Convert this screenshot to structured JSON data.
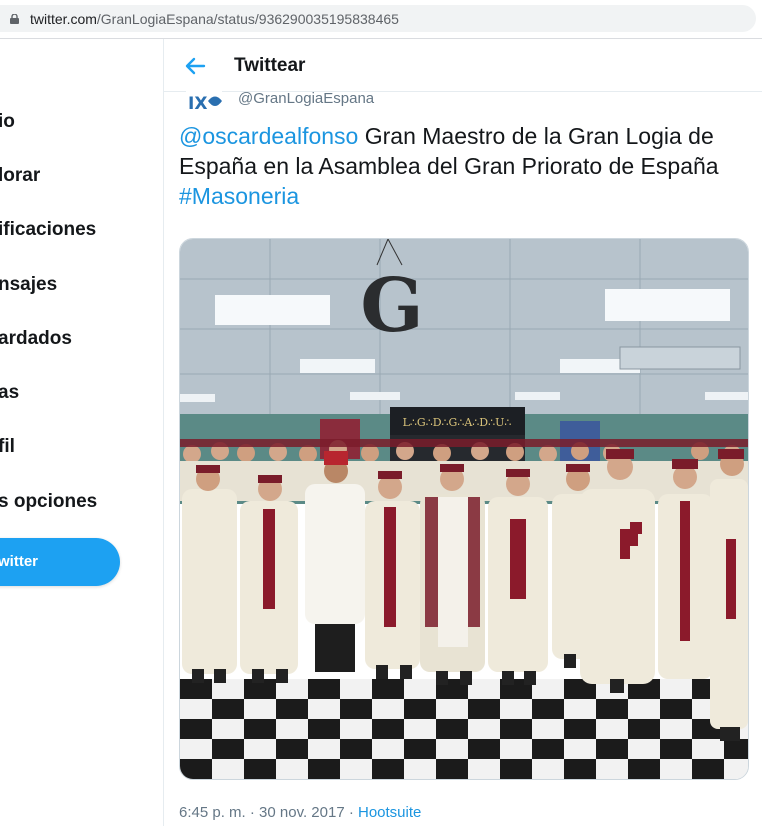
{
  "browser": {
    "url_host": "twitter.com",
    "url_path": "/GranLogiaEspana/status/936290035195838465"
  },
  "sidebar": {
    "items": [
      {
        "label": "io"
      },
      {
        "label": "lorar"
      },
      {
        "label": "ificaciones"
      },
      {
        "label": "nsajes"
      },
      {
        "label": "ardados"
      },
      {
        "label": "as"
      },
      {
        "label": "fil"
      },
      {
        "label": "s opciones"
      }
    ],
    "tweet_button": "witter"
  },
  "header": {
    "title": "Twittear"
  },
  "tweet": {
    "handle": "@GranLogiaEspana",
    "mention": "@oscardealfonso",
    "text": " Gran Maestro de la Gran Logia de España en la Asamblea del Gran Priorato de España ",
    "hashtag": "#Masoneria",
    "timestamp": "6:45 p. m. · 30 nov. 2017 · ",
    "source": "Hootsuite"
  },
  "photo": {
    "sign_letter": "G",
    "banner_text": "L∴G∴D∴G∴A∴D∴U∴"
  },
  "colors": {
    "accent": "#1da1f2",
    "link": "#1b95e0",
    "robe": "#efeadb",
    "cross": "#8b1a2b"
  }
}
